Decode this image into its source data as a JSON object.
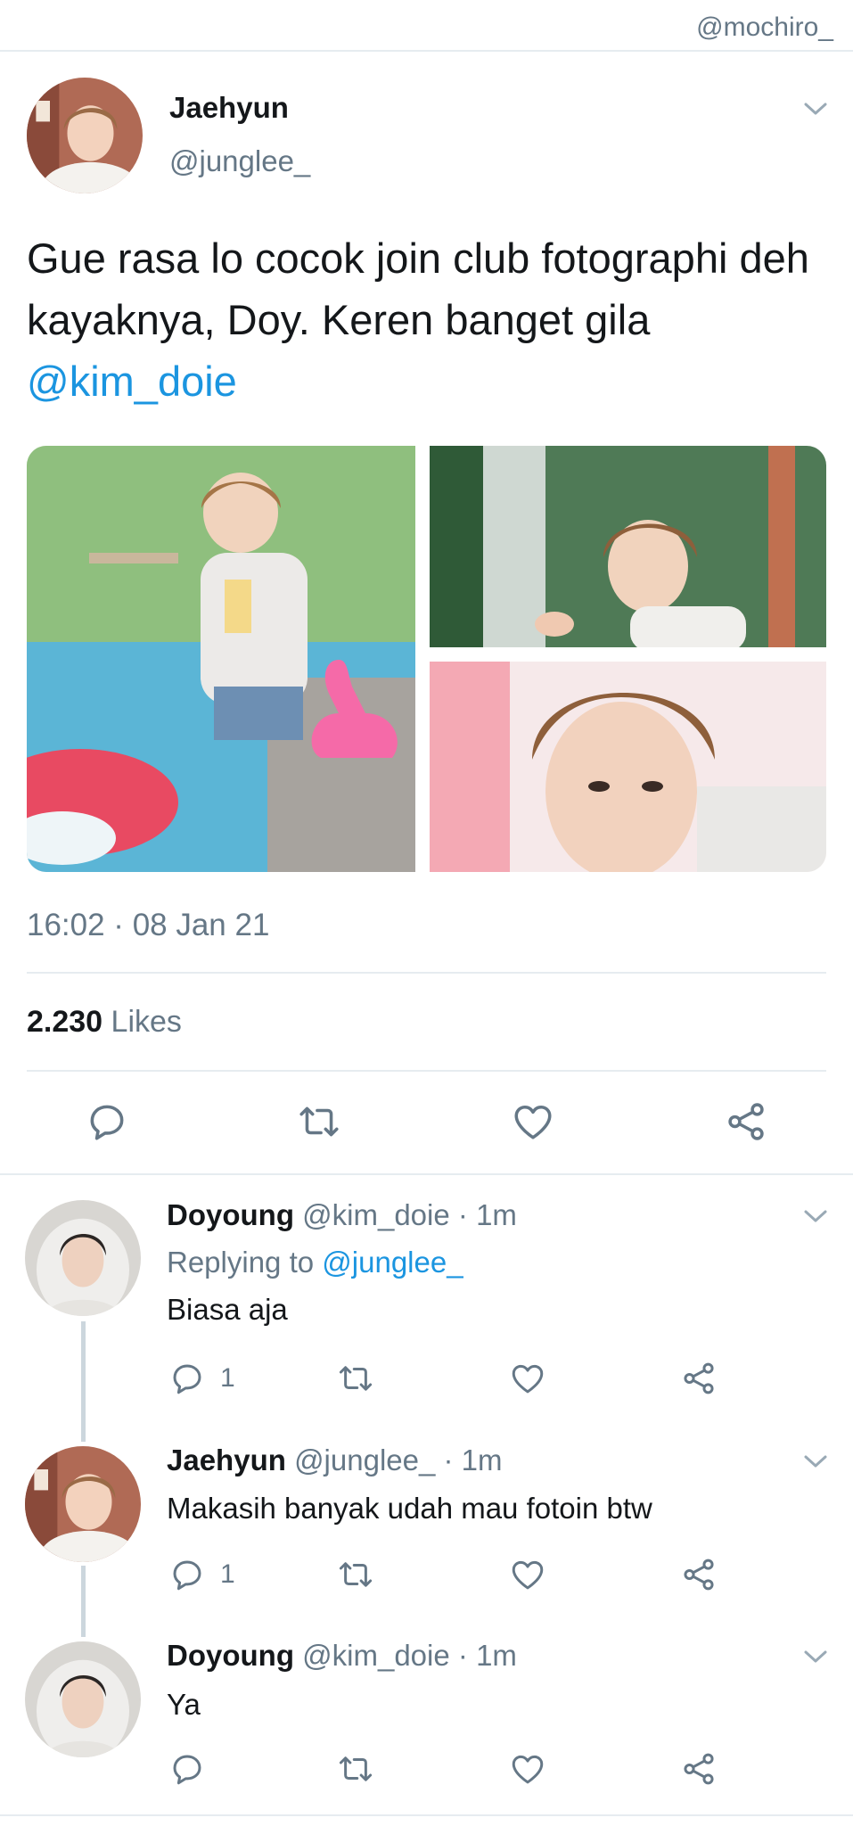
{
  "watermark": "@mochiro_",
  "main_tweet": {
    "name": "Jaehyun",
    "handle": "@junglee_",
    "text": "Gue rasa lo cocok join club fotographi deh kayaknya, Doy. Keren banget gila",
    "mention": "@kim_doie",
    "timestamp": "16:02 · 08 Jan 21",
    "likes_count": "2.230",
    "likes_label": "Likes"
  },
  "replies": [
    {
      "name": "Doyoung",
      "handle": "@kim_doie",
      "time": "· 1m",
      "replying_label": "Replying to",
      "replying_to": "@junglee_",
      "text": "Biasa aja",
      "reply_count": "1"
    },
    {
      "name": "Jaehyun",
      "handle": "@junglee_",
      "time": "· 1m",
      "text": "Makasih banyak udah mau fotoin btw",
      "reply_count": "1"
    },
    {
      "name": "Doyoung",
      "handle": "@kim_doie",
      "time": "· 1m",
      "text": "Ya"
    }
  ],
  "icons": {
    "reply": "reply-icon",
    "retweet": "retweet-icon",
    "like": "heart-icon",
    "share": "share-icon",
    "more": "chevron-down-icon"
  },
  "colors": {
    "link": "#1b95e0",
    "secondary_text": "#657786",
    "separator": "#e6ecf0"
  }
}
